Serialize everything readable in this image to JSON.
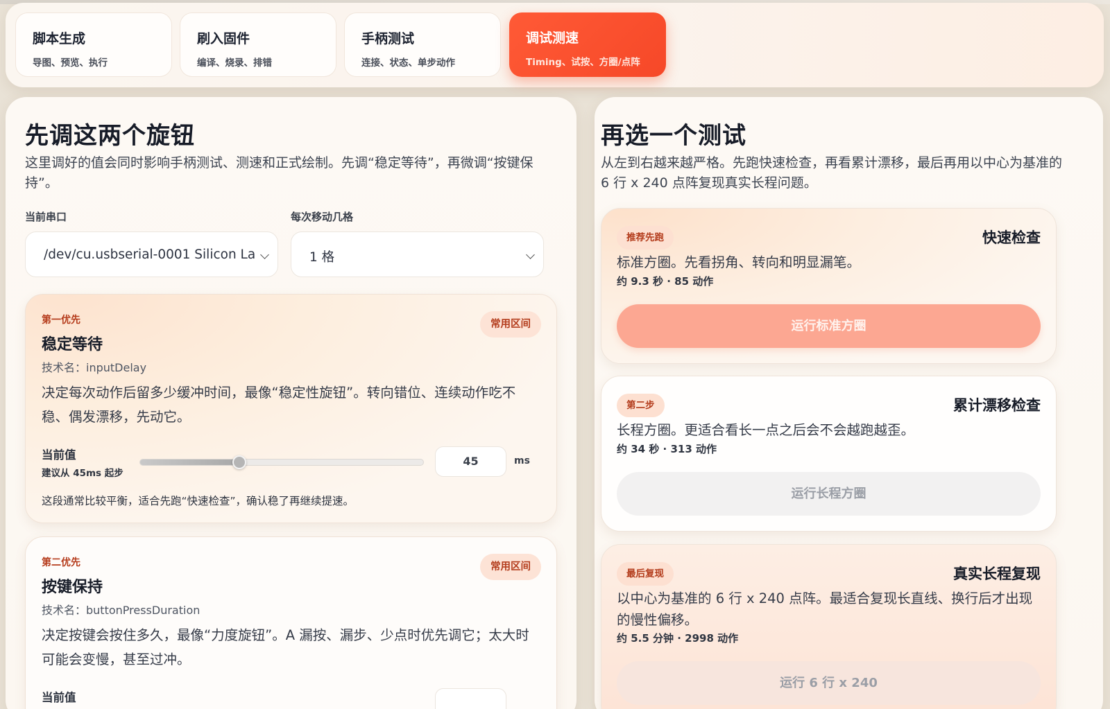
{
  "tabs": [
    {
      "title": "脚本生成",
      "subtitle": "导图、预览、执行"
    },
    {
      "title": "刷入固件",
      "subtitle": "编译、烧录、排错"
    },
    {
      "title": "手柄测试",
      "subtitle": "连接、状态、单步动作"
    },
    {
      "title": "调试测速",
      "subtitle": "Timing、试按、方圈/点阵",
      "active": true
    }
  ],
  "left": {
    "heading": "先调这两个旋钮",
    "description": "这里调好的值会同时影响手柄测试、测速和正式绘制。先调“稳定等待”，再微调“按键保持”。",
    "port_label": "当前串口",
    "port_value": "/dev/cu.usbserial-0001 Silicon La",
    "step_label": "每次移动几格",
    "step_value": "1 格",
    "knobs": [
      {
        "priority": "第一优先",
        "badge": "常用区间",
        "title": "稳定等待",
        "tech_name": "技术名：inputDelay",
        "description": "决定每次动作后留多少缓冲时间，最像“稳定性旋钮”。转向错位、连续动作吃不稳、偶发漂移，先动它。",
        "current_label": "当前值",
        "suggestion": "建议从 45ms 起步",
        "value": "45",
        "unit": "ms",
        "slider_fraction": 0.35,
        "note": "这段通常比较平衡，适合先跑“快速检查”，确认稳了再继续提速。"
      },
      {
        "priority": "第二优先",
        "badge": "常用区间",
        "title": "按键保持",
        "tech_name": "技术名：buttonPressDuration",
        "description": "决定按键会按住多久，最像“力度旋钮”。A 漏按、漏步、少点时优先调它；太大时可能会变慢，甚至过冲。",
        "current_label": "当前值"
      }
    ]
  },
  "right": {
    "heading": "再选一个测试",
    "description": "从左到右越来越严格。先跑快速检查，再看累计漂移，最后再用以中心为基准的 6 行 x 240 点阵复现真实长程问题。",
    "tests": [
      {
        "badge": "推荐先跑",
        "title": "快速检查",
        "description": "标准方圈。先看拐角、转向和明显漏笔。",
        "meta": "约 9.3 秒 · 85 动作",
        "button": "运行标准方圈"
      },
      {
        "badge": "第二步",
        "title": "累计漂移检查",
        "description": "长程方圈。更适合看长一点之后会不会越跑越歪。",
        "meta": "约 34 秒 · 313 动作",
        "button": "运行长程方圈"
      },
      {
        "badge": "最后复现",
        "title": "真实长程复现",
        "description": "以中心为基准的 6 行 x 240 点阵。最适合复现长直线、换行后才出现的慢性偏移。",
        "meta": "约 5.5 分钟 · 2998 动作",
        "button": "运行 6 行 x 240"
      }
    ]
  },
  "colors": {
    "accent": "#f64828",
    "badge_bg": "#fde3d6",
    "badge_text": "#b43e1e",
    "primary_button": "#fca792"
  }
}
